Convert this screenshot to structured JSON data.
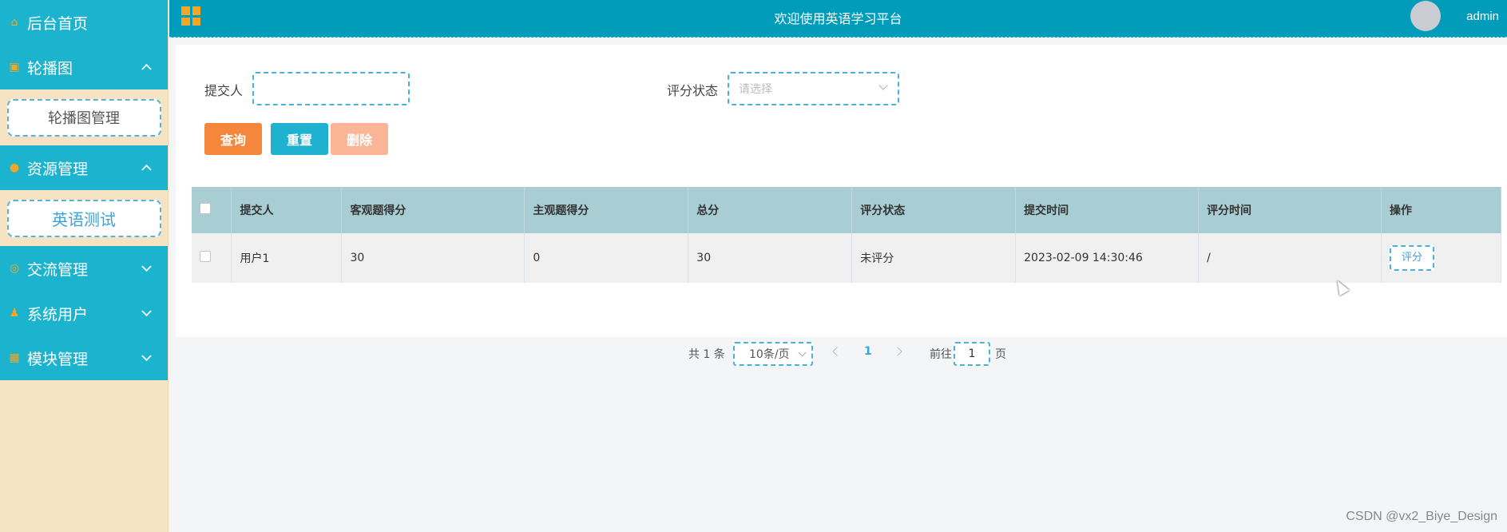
{
  "sidebar": {
    "items": [
      {
        "label": "后台首页",
        "icon": "home-icon"
      },
      {
        "label": "轮播图",
        "icon": "image-icon",
        "expanded": true,
        "children": [
          {
            "label": "轮播图管理"
          }
        ]
      },
      {
        "label": "资源管理",
        "icon": "pin-icon",
        "expanded": true,
        "children": [
          {
            "label": "英语测试",
            "active": true
          }
        ]
      },
      {
        "label": "交流管理",
        "icon": "chat-icon",
        "expanded": false
      },
      {
        "label": "系统用户",
        "icon": "user-icon",
        "expanded": false
      },
      {
        "label": "模块管理",
        "icon": "grid-icon",
        "expanded": false
      }
    ]
  },
  "header": {
    "title": "欢迎使用英语学习平台",
    "user": "admin"
  },
  "search": {
    "submitter_label": "提交人",
    "submitter_value": "",
    "status_label": "评分状态",
    "status_placeholder": "请选择"
  },
  "buttons": {
    "query": "查询",
    "reset": "重置",
    "delete": "删除"
  },
  "table": {
    "columns": [
      "提交人",
      "客观题得分",
      "主观题得分",
      "总分",
      "评分状态",
      "提交时间",
      "评分时间",
      "操作"
    ],
    "rows": [
      {
        "submitter": "用户1",
        "objective_score": "30",
        "subjective_score": "0",
        "total": "30",
        "status": "未评分",
        "submit_time": "2023-02-09 14:30:46",
        "rate_time": "/",
        "action": "评分"
      }
    ]
  },
  "pagination": {
    "total_text": "共 1 条",
    "page_size": "10条/页",
    "current_page": "1",
    "goto_label": "前往",
    "goto_value": "1",
    "page_suffix": "页"
  },
  "watermark": "CSDN @vx2_Biye_Design",
  "colors": {
    "header": "#009cb9",
    "sidebar_item": "#1cb3cf",
    "sidebar_bg": "#f5e3c3",
    "query_button": "#f5873c",
    "reset_button": "#1fb2d0",
    "delete_button": "#f9b596",
    "table_header": "#a8cdd3"
  }
}
